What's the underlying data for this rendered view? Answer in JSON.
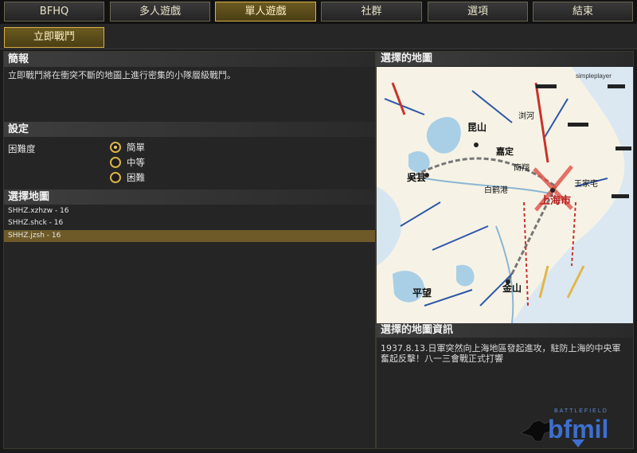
{
  "nav": {
    "tabs": [
      {
        "label": "BFHQ"
      },
      {
        "label": "多人遊戲"
      },
      {
        "label": "單人遊戲"
      },
      {
        "label": "社群"
      },
      {
        "label": "選項"
      },
      {
        "label": "結束"
      }
    ],
    "active_tab": "單人遊戲"
  },
  "subnav": {
    "button": "立即戰鬥"
  },
  "brief": {
    "heading": "簡報",
    "text": "立即戰鬥將在衝突不斷的地圖上進行密集的小隊層級戰鬥。"
  },
  "settings": {
    "heading": "設定",
    "difficulty_label": "困難度",
    "options": [
      "簡單",
      "中等",
      "困難"
    ],
    "selected": "簡單"
  },
  "map_select": {
    "heading": "選擇地圖",
    "maps": [
      "SHHZ.xzhzw - 16",
      "SHHZ.shck - 16",
      "SHHZ.jzsh - 16"
    ],
    "selected_index": 2
  },
  "selected_map": {
    "heading": "選擇的地圖",
    "image_places": {
      "wuxian": "吳县",
      "kunshan": "昆山",
      "jiading": "嘉定",
      "nanxiang": "南翔",
      "shanghai": "上海市",
      "wangjiazhai": "王家宅",
      "jinshan": "金山",
      "pingwang": "平望",
      "liuhe": "浏河",
      "baiheshi": "白鹤港",
      "watermark": "simpleplayer"
    }
  },
  "map_info": {
    "heading": "選擇的地圖資訊",
    "text": "1937.8.13.日軍突然向上海地區發起進攻，駐防上海的中央軍奮起反擊！八一三會戰正式打響"
  },
  "logo": {
    "small": "BATTLEFIELD",
    "big": "bfmil"
  },
  "colors": {
    "accent": "#d9b24a",
    "selected_row": "#6e5a28",
    "panel": "#252525"
  }
}
